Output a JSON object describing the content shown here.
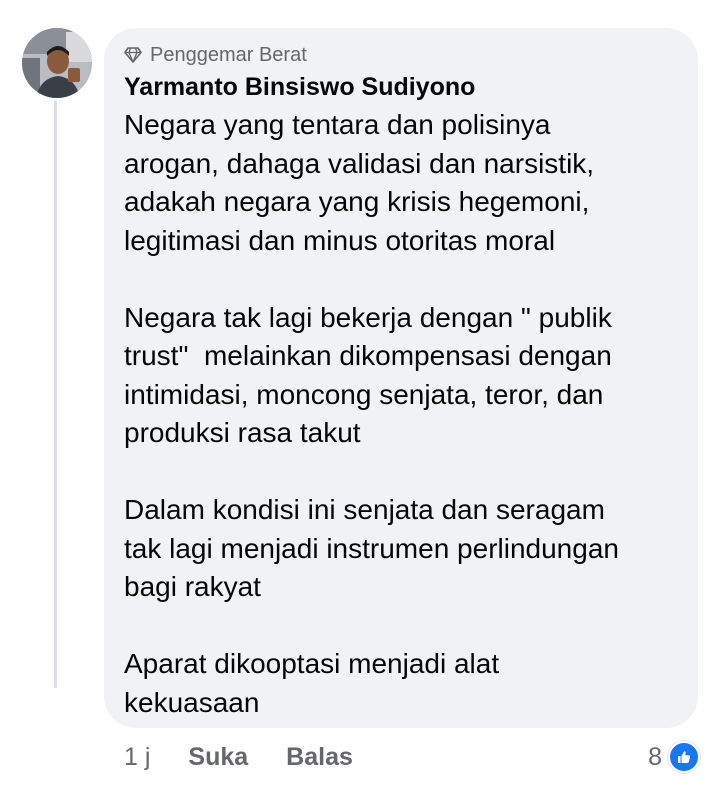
{
  "comment": {
    "badge": "Penggemar Berat",
    "badge_icon": "diamond-icon",
    "author": "Yarmanto Binsiswo Sudiyono",
    "paragraphs": [
      "Negara yang tentara dan polisinya\narogan, dahaga validasi dan narsistik,\nadakah negara yang krisis hegemoni,\nlegitimasi dan minus otoritas moral",
      "Negara tak lagi bekerja dengan \" publik\ntrust\"  melainkan dikompensasi dengan\nintimidasi, moncong senjata, teror, dan\nproduksi rasa takut",
      "Dalam kondisi ini senjata dan seragam\ntak lagi menjadi instrumen perlindungan\nbagi rakyat",
      "Aparat dikooptasi menjadi alat\nkekuasaan"
    ]
  },
  "actions": {
    "time": "1 j",
    "like_label": "Suka",
    "reply_label": "Balas"
  },
  "reactions": {
    "count": "8",
    "icon": "thumbs-up-icon",
    "color": "#1877f2"
  }
}
